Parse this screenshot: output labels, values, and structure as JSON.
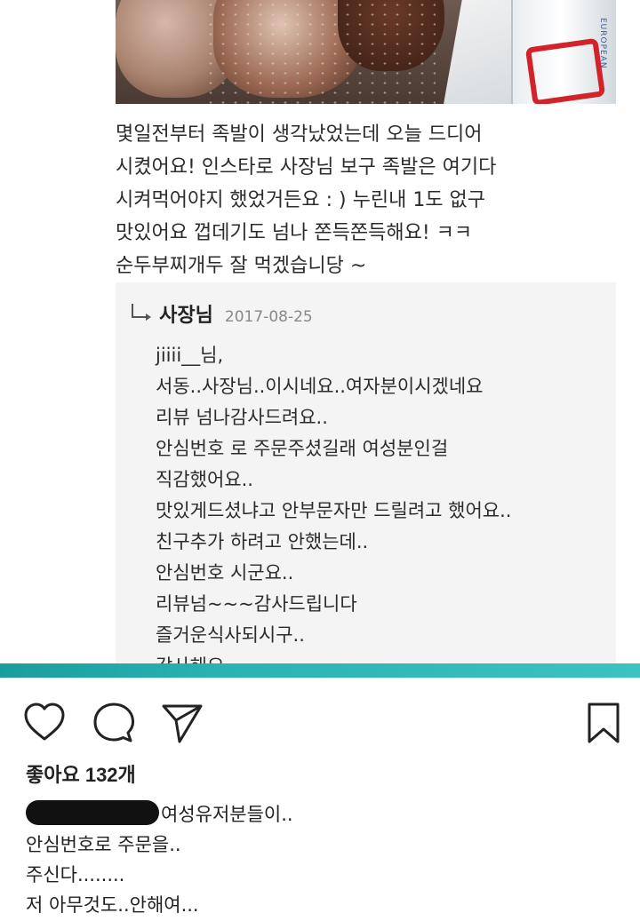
{
  "post_image": {
    "photo": {
      "icon": "food-photo",
      "brand_text": "EUROPEAN"
    },
    "review": {
      "lines": [
        "몇일전부터 족발이 생각났었는데 오늘 드디어",
        "시켰어요! 인스타로 사장님 보구 족발은 여기다",
        "시켜먹어야지 했었거든요 : ) 누린내 1도 없구",
        "맛있어요 껍데기도 넘나 쫀득쫀득해요! ㅋㅋ",
        "순두부찌개두 잘 먹겠습니당 ~"
      ]
    },
    "owner_reply": {
      "icon": "reply-arrow-icon",
      "author": "사장님",
      "date": "2017-08-25",
      "lines": [
        "jiiii__님,",
        "서동..사장님..이시네요..여자분이시겠네요",
        "리뷰 넘나감사드려요..",
        "안심번호 로 주문주셨길래 여성분인걸",
        "직감했어요..",
        "맛있게드셨냐고  안부문자만 드릴려고 했어요..",
        "친구추가 하려고 안했는데..",
        "안심번호 시군요..",
        "리뷰넘~~~감사드립니다",
        "즐거운식사되시구..",
        "감사해요~~~~~~"
      ]
    }
  },
  "actions": {
    "like_icon": "heart-icon",
    "comment_icon": "comment-icon",
    "share_icon": "send-icon",
    "save_icon": "bookmark-icon"
  },
  "likes": {
    "text": "좋아요 132개"
  },
  "caption": {
    "first_line": "여성유저분들이..",
    "lines": [
      "안심번호로 주문을..",
      "주신다........",
      "저 아무것도..안해여..."
    ]
  },
  "colors": {
    "divider": "#29b3b3",
    "reply_background": "#f4f4f4",
    "text": "#222222"
  }
}
